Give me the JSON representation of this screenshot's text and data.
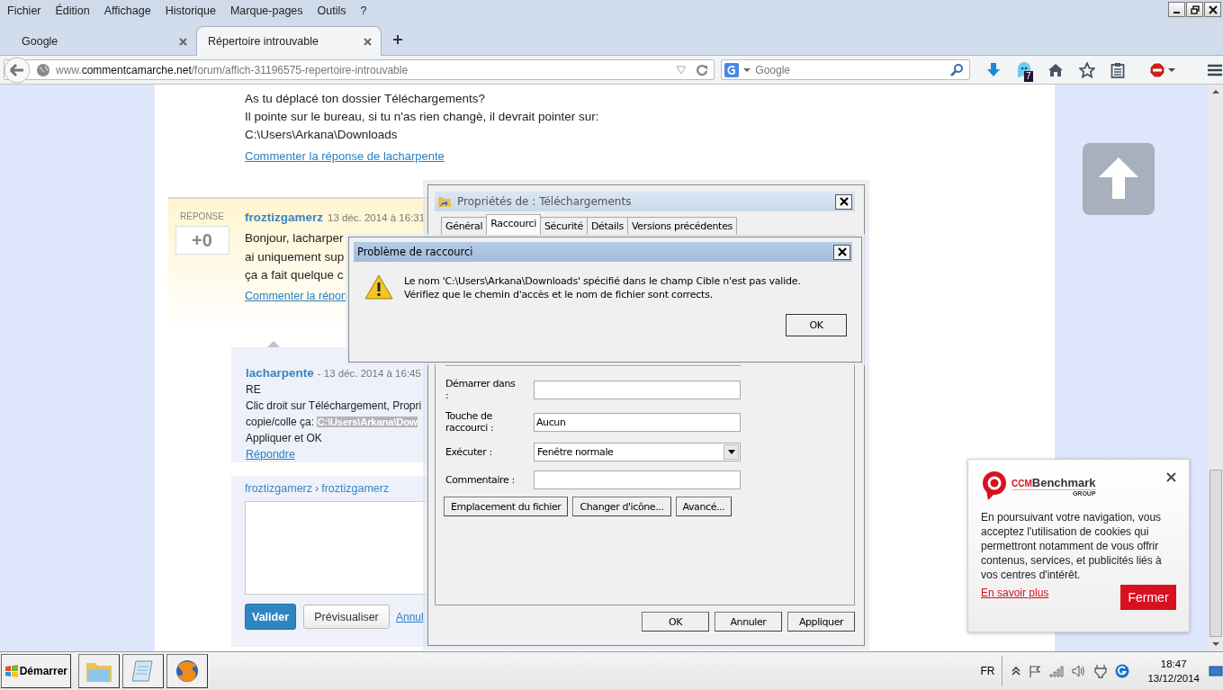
{
  "menu": [
    "Fichier",
    "Édition",
    "Affichage",
    "Historique",
    "Marque-pages",
    "Outils",
    "?"
  ],
  "tabs": [
    {
      "label": "Google",
      "selected": false
    },
    {
      "label": "Répertoire introuvable",
      "selected": true
    }
  ],
  "address_bar": {
    "url": {
      "prefix": "www.",
      "domain": "commentcamarche.net",
      "path": "/forum/affich-31196575-repertoire-introuvable"
    }
  },
  "search": {
    "placeholder": "Google"
  },
  "toolbar": {
    "badge": "7"
  },
  "page": {
    "previous_answer": {
      "lines": [
        "As tu déplacé ton dossier Téléchargements?",
        "Il pointe sur le bureau, si tu n'as rien changè, il devrait pointer sur:",
        "C:\\Users\\Arkana\\Downloads"
      ],
      "comment_link": "Commenter la réponse de lacharpente"
    },
    "answer": {
      "vote_label": "RÉPONSE",
      "score": "+0",
      "author": "froztizgamerz",
      "date": "13 déc. 2014 à 16:31",
      "lines": [
        "Bonjour, lacharper",
        "ai uniquement sup",
        "ça a fait quelque c"
      ],
      "comment_link": "Commenter la répon"
    },
    "comment": {
      "author": "lacharpente",
      "date": "- 13 déc. 2014 à 16:45",
      "lines": [
        {
          "kind": "plain",
          "text": "RE"
        },
        {
          "kind": "plain",
          "text": "Clic droit sur Téléchargement, Propri"
        },
        {
          "kind": "highlighted",
          "text": "copie/colle ça:",
          "highlight": "C:\\Users\\Arkana\\Dow"
        },
        {
          "kind": "plain",
          "text": "Appliquer et OK"
        }
      ],
      "reply_link": "Répondre"
    },
    "reply_form": {
      "breadcrumb": [
        "froztizgamerz",
        "froztizgamerz"
      ],
      "separator": "›",
      "submit": "Valider",
      "preview": "Prévisualiser",
      "cancel": "Annul"
    }
  },
  "properties_dialog": {
    "title": "Propriétés de : Téléchargements",
    "tabs": [
      {
        "label": "Général",
        "selected": false
      },
      {
        "label": "Raccourci",
        "selected": true
      },
      {
        "label": "Sécurité",
        "selected": false
      },
      {
        "label": "Détails",
        "selected": false
      },
      {
        "label": "Versions précédentes",
        "selected": false
      }
    ],
    "fields": [
      {
        "label": "Démarrer dans :",
        "kind": "text"
      },
      {
        "label": "Touche de raccourci :",
        "kind": "text",
        "value": "Aucun"
      },
      {
        "label": "Exécuter :",
        "kind": "select",
        "value": "Fenêtre normale"
      },
      {
        "label": "Commentaire :",
        "kind": "text"
      }
    ],
    "actions": [
      "Emplacement du fichier",
      "Changer d'icône...",
      "Avancé..."
    ],
    "buttons": [
      "OK",
      "Annuler",
      "Appliquer"
    ]
  },
  "error_dialog": {
    "title": "Problème de raccourci",
    "message": "Le nom 'C:\\Users\\Arkana\\Downloads' spécifié dans le champ Cible n'est pas valide. Vérifiez que le chemin d'accès et le nom de fichier sont corrects.",
    "button": "OK"
  },
  "cookie_notice": {
    "brand": {
      "prefix": "CCM",
      "name": "Benchmark",
      "group": "GROUP"
    },
    "message": "En poursuivant votre navigation, vous acceptez l'utilisation de cookies qui permettront notamment de vous offrir contenus, services, et publicités liés à vos centres d'intérêt.",
    "link": "En savoir plus",
    "button": "Fermer"
  },
  "taskbar": {
    "start": "Démarrer",
    "language": "FR",
    "time": "18:47",
    "date": "13/12/2014"
  }
}
